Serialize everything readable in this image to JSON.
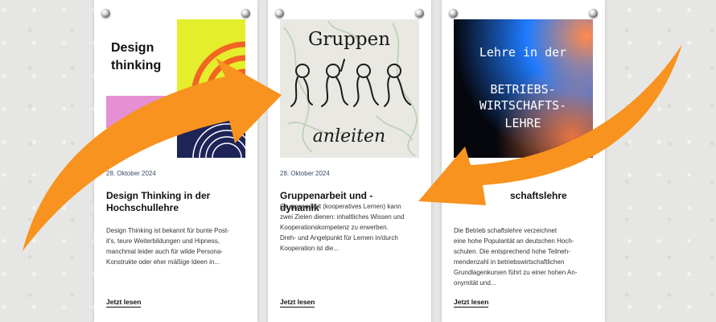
{
  "cards": [
    {
      "image_title_line1": "Design",
      "image_title_line2": "thinking",
      "date": "28. Oktober 2024",
      "title_line1": "Design Thinking in der",
      "title_line2": "Hochschullehre",
      "excerpt": [
        "Design Thinking ist bekannt für bunte Post-",
        "it's, teure Weiterbildungen und Hipness,",
        "manchmal leider auch für wilde Persona-",
        "Konstrukte oder eher mäßige Ideen in..."
      ],
      "link": "Jetzt lesen"
    },
    {
      "image_title_line1": "Gruppen",
      "image_title_line2": "anleiten",
      "date": "28. Oktober 2024",
      "title_line1": "Gruppenarbeit und -",
      "title_line2": "dynamik",
      "excerpt": [
        "Gruppenarbeit (kooperatives Lernen) kann",
        "zwei Zielen dienen: inhaltliches Wissen und",
        "Kooperationskompetenz zu erwerben.",
        "Dreh- und Angelpunkt für Lernen in/durch",
        "Kooperation ist die..."
      ],
      "link": "Jetzt lesen"
    },
    {
      "image_title_line1": "Lehre in der",
      "image_title_line2": "BETRIEBS-",
      "image_title_line3": "WIRTSCHAFTS-",
      "image_title_line4": "LEHRE",
      "date": "",
      "title_line1": "",
      "title_line2": "schaftslehre",
      "excerpt": [
        "Die Betrieb  schaftslehre verzeichnet",
        "eine hohe Popularität an deutschen Hoch-",
        "schulen. Die entsprechend hohe Teilneh-",
        "mendenzahl in betriebswirtschaftlichen",
        "Grundlagenkursen führt zu einer hohen An-",
        "onymität und..."
      ],
      "link": "Jetzt lesen"
    }
  ],
  "colors": {
    "arrow": "#f7931e",
    "yellow": "#e4ee2c",
    "orange": "#f26522",
    "pink": "#e68fd3",
    "navy": "#1f2458"
  }
}
